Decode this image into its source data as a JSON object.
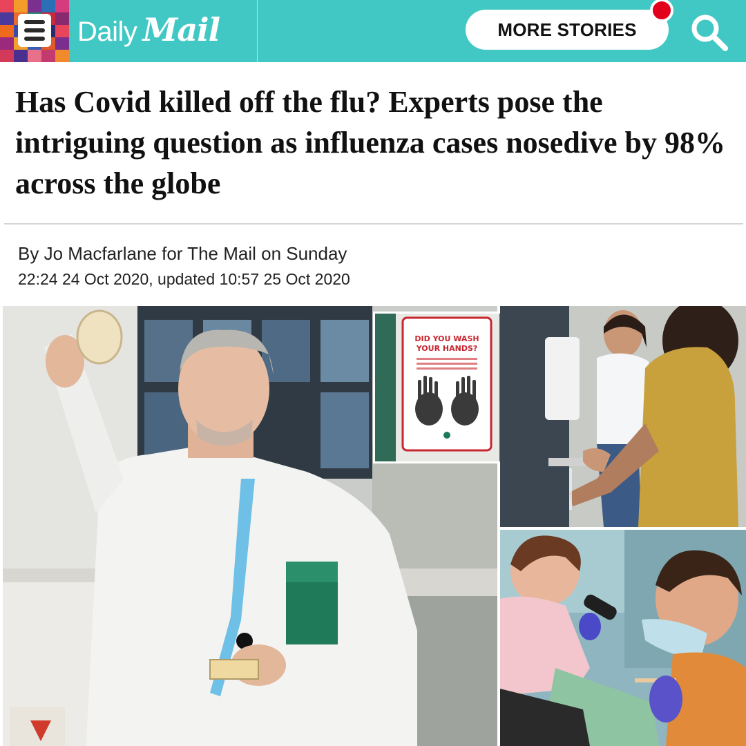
{
  "header": {
    "menu_icon": "hamburger-menu-icon",
    "brand_daily": "Daily",
    "brand_mail": "Mail",
    "more_stories_label": "MORE STORIES",
    "search_icon": "search-icon",
    "colors": {
      "header_bg": "#42c8c4",
      "notification_dot": "#e3001b"
    }
  },
  "article": {
    "headline": "Has Covid killed off the flu? Experts pose the intriguing question as influenza cases nosedive by 98% across the globe",
    "byline": "By Jo Macfarlane for The Mail on Sunday",
    "timestamp": "22:24 24 Oct 2020, updated 10:57 25 Oct 2020"
  },
  "images": {
    "sign_line1": "DID YOU WASH",
    "sign_line2": "YOUR HANDS?"
  }
}
